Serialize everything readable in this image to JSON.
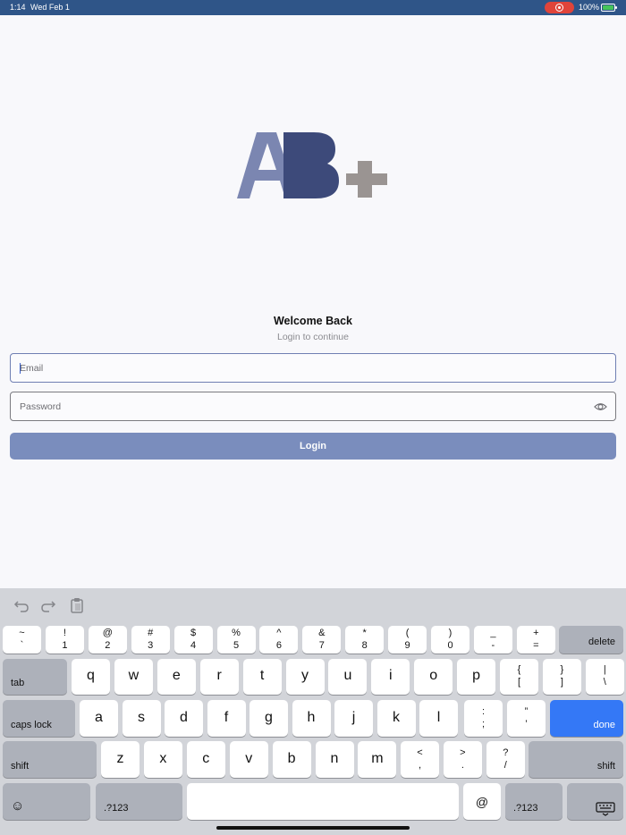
{
  "status_bar": {
    "time": "1:14",
    "date": "Wed Feb 1",
    "battery": "100%"
  },
  "colors": {
    "status_bar": "#2f5588",
    "logo_a": "#7b86b1",
    "logo_b": "#3d4a7a",
    "logo_plus": "#9a9492",
    "login_button": "#7a8dbd",
    "done_key": "#3478f6"
  },
  "logo": {
    "text": "AB+"
  },
  "welcome": {
    "title": "Welcome Back",
    "subtitle": "Login to continue"
  },
  "form": {
    "email_placeholder": "Email",
    "email_value": "",
    "password_placeholder": "Password",
    "password_value": "",
    "password_toggle_icon": "eye-icon",
    "login_label": "Login"
  },
  "keyboard": {
    "shortcuts": [
      "undo-icon",
      "redo-icon",
      "paste-icon"
    ],
    "row1": [
      {
        "top": "~",
        "bot": "`"
      },
      {
        "top": "!",
        "bot": "1"
      },
      {
        "top": "@",
        "bot": "2"
      },
      {
        "top": "#",
        "bot": "3"
      },
      {
        "top": "$",
        "bot": "4"
      },
      {
        "top": "%",
        "bot": "5"
      },
      {
        "top": "^",
        "bot": "6"
      },
      {
        "top": "&",
        "bot": "7"
      },
      {
        "top": "*",
        "bot": "8"
      },
      {
        "top": "(",
        "bot": "9"
      },
      {
        "top": ")",
        "bot": "0"
      },
      {
        "top": "_",
        "bot": "-"
      },
      {
        "top": "+",
        "bot": "="
      }
    ],
    "delete": "delete",
    "tab": "tab",
    "row2": [
      "q",
      "w",
      "e",
      "r",
      "t",
      "y",
      "u",
      "i",
      "o",
      "p"
    ],
    "row2_sym": [
      {
        "top": "{",
        "bot": "["
      },
      {
        "top": "}",
        "bot": "]"
      },
      {
        "top": "|",
        "bot": "\\"
      }
    ],
    "caps_lock": "caps lock",
    "row3": [
      "a",
      "s",
      "d",
      "f",
      "g",
      "h",
      "j",
      "k",
      "l"
    ],
    "row3_sym": [
      {
        "top": ":",
        "bot": ";"
      },
      {
        "top": "”",
        "bot": "’"
      }
    ],
    "done": "done",
    "shift_left": "shift",
    "row4": [
      "z",
      "x",
      "c",
      "v",
      "b",
      "n",
      "m"
    ],
    "row4_sym": [
      {
        "top": "<",
        "bot": ","
      },
      {
        "top": ">",
        "bot": "."
      },
      {
        "top": "?",
        "bot": "/"
      }
    ],
    "shift_right": "shift",
    "emoji": "☺",
    "numbers_left": ".?123",
    "at": "@",
    "numbers_right": ".?123",
    "dismiss_icon": "keyboard-dismiss-icon"
  }
}
